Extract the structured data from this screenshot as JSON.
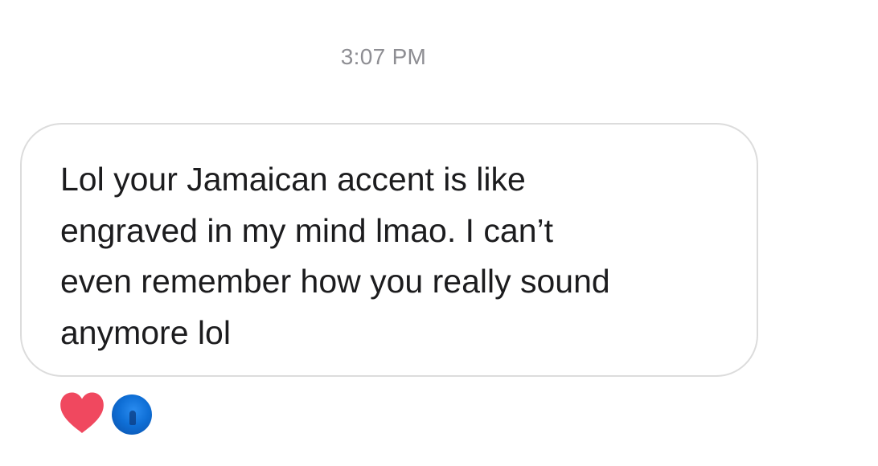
{
  "conversation": {
    "timestamp": "3:07 PM",
    "message": {
      "text": "Lol your Jamaican accent is like\nengraved in my mind lmao. I can’t\neven remember how you really sound\nanymore lol"
    },
    "reactions": [
      {
        "icon": "heart-icon",
        "color": "#f0485f"
      }
    ],
    "reactor_avatar": {
      "color": "#1473e6"
    }
  }
}
